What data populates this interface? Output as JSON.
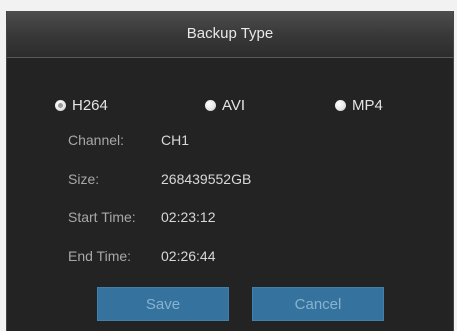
{
  "dialog": {
    "title": "Backup Type"
  },
  "formats": [
    {
      "label": "H264",
      "selected": true
    },
    {
      "label": "AVI",
      "selected": false
    },
    {
      "label": "MP4",
      "selected": false
    }
  ],
  "fields": {
    "channel": {
      "label": "Channel:",
      "value": "CH1"
    },
    "size": {
      "label": "Size:",
      "value": "268439552GB"
    },
    "start_time": {
      "label": "Start Time:",
      "value": "02:23:12"
    },
    "end_time": {
      "label": "End Time:",
      "value": "02:26:44"
    }
  },
  "buttons": {
    "save": "Save",
    "cancel": "Cancel"
  },
  "colors": {
    "dialog_bg": "#232323",
    "button_bg": "#35729e",
    "button_text": "#86b3d1"
  }
}
